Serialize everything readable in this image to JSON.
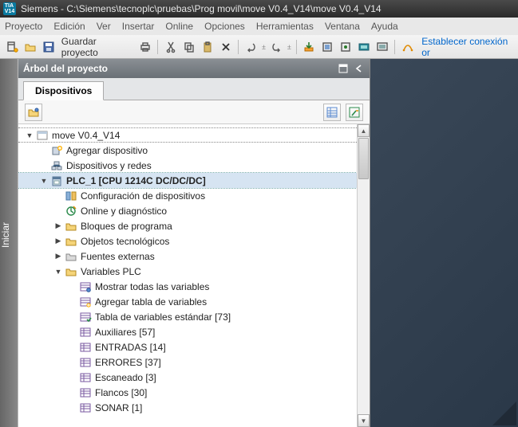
{
  "title": {
    "app": "Siemens",
    "sep": "  -  ",
    "path": "C:\\Siemens\\tecnoplc\\pruebas\\Prog movil\\move V0.4_V14\\move V0.4_V14"
  },
  "menu": [
    "Proyecto",
    "Edición",
    "Ver",
    "Insertar",
    "Online",
    "Opciones",
    "Herramientas",
    "Ventana",
    "Ayuda"
  ],
  "toolbar": {
    "save_label": "Guardar proyecto",
    "connect_label": "Establecer conexión or"
  },
  "panel": {
    "title": "Árbol del proyecto",
    "tab": "Dispositivos"
  },
  "side": {
    "label": "Iniciar"
  },
  "tree": [
    {
      "depth": 0,
      "exp": "down",
      "icon": "project",
      "label": "move V0.4_V14",
      "style": "root"
    },
    {
      "depth": 1,
      "exp": "",
      "icon": "adddev",
      "label": "Agregar dispositivo"
    },
    {
      "depth": 1,
      "exp": "",
      "icon": "netdev",
      "label": "Dispositivos y redes"
    },
    {
      "depth": 1,
      "exp": "down",
      "icon": "plc",
      "label": "PLC_1 [CPU 1214C DC/DC/DC]",
      "style": "bold selected"
    },
    {
      "depth": 2,
      "exp": "",
      "icon": "devcfg",
      "label": "Configuración de dispositivos"
    },
    {
      "depth": 2,
      "exp": "",
      "icon": "diag",
      "label": "Online y diagnóstico"
    },
    {
      "depth": 2,
      "exp": "right",
      "icon": "folder",
      "label": "Bloques de programa"
    },
    {
      "depth": 2,
      "exp": "right",
      "icon": "folder",
      "label": "Objetos tecnológicos"
    },
    {
      "depth": 2,
      "exp": "right",
      "icon": "folder-ext",
      "label": "Fuentes externas"
    },
    {
      "depth": 2,
      "exp": "down",
      "icon": "folder",
      "label": "Variables PLC"
    },
    {
      "depth": 3,
      "exp": "",
      "icon": "tagall",
      "label": "Mostrar todas las variables"
    },
    {
      "depth": 3,
      "exp": "",
      "icon": "tagadd",
      "label": "Agregar tabla de variables"
    },
    {
      "depth": 3,
      "exp": "",
      "icon": "tagstd",
      "label": "Tabla de variables estándar [73]"
    },
    {
      "depth": 3,
      "exp": "",
      "icon": "tagtbl",
      "label": "Auxiliares [57]"
    },
    {
      "depth": 3,
      "exp": "",
      "icon": "tagtbl",
      "label": "ENTRADAS [14]"
    },
    {
      "depth": 3,
      "exp": "",
      "icon": "tagtbl",
      "label": "ERRORES [37]"
    },
    {
      "depth": 3,
      "exp": "",
      "icon": "tagtbl",
      "label": "Escaneado [3]"
    },
    {
      "depth": 3,
      "exp": "",
      "icon": "tagtbl",
      "label": "Flancos [30]"
    },
    {
      "depth": 3,
      "exp": "",
      "icon": "tagtbl",
      "label": "SONAR [1]"
    }
  ]
}
